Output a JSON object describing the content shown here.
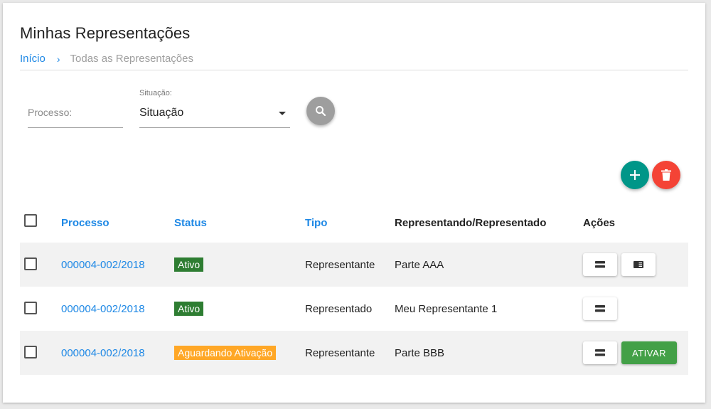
{
  "page": {
    "title": "Minhas Representações",
    "breadcrumb": {
      "home": "Início",
      "separator": "›",
      "current": "Todas as Representações"
    }
  },
  "filters": {
    "processo": {
      "placeholder": "Processo:",
      "value": ""
    },
    "situacao": {
      "label": "Situação:",
      "selected": "Situação"
    },
    "search_icon": "search-icon"
  },
  "fabs": {
    "add_icon": "plus-icon",
    "delete_icon": "trash-icon",
    "add_color": "#009688",
    "delete_color": "#f44336"
  },
  "table": {
    "columns": [
      "Processo",
      "Status",
      "Tipo",
      "Representando/Representado",
      "Ações"
    ],
    "rows": [
      {
        "processo": "000004-002/2018",
        "status": "Ativo",
        "status_color": "#2e7d32",
        "tipo": "Representante",
        "representando": "Parte AAA",
        "actions": [
          "detail-icon",
          "card-icon"
        ]
      },
      {
        "processo": "000004-002/2018",
        "status": "Ativo",
        "status_color": "#2e7d32",
        "tipo": "Representado",
        "representando": "Meu Representante 1",
        "actions": [
          "detail-icon"
        ]
      },
      {
        "processo": "000004-002/2018",
        "status": "Aguardando Ativação",
        "status_color": "#ffa726",
        "tipo": "Representante",
        "representando": "Parte BBB",
        "actions": [
          "detail-icon"
        ],
        "activate_label": "ATIVAR"
      }
    ]
  },
  "colors": {
    "link": "#1e88e5",
    "row_shade": "#f2f2f2",
    "activate": "#43a047"
  }
}
